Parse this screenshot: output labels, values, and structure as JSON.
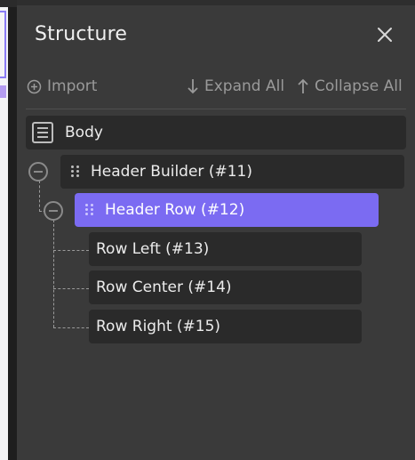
{
  "panel": {
    "title": "Structure"
  },
  "toolbar": {
    "import_label": "Import",
    "expand_all_label": "Expand All",
    "collapse_all_label": "Collapse All"
  },
  "tree": {
    "body": "Body",
    "header_builder": "Header Builder (#11)",
    "header_row": "Header Row (#12)",
    "row_left": "Row Left (#13)",
    "row_center": "Row Center (#14)",
    "row_right": "Row Right (#15)"
  },
  "colors": {
    "panel_bg": "#3a3a3a",
    "row_bg": "#2a2a2a",
    "selected_accent": "#7b6bf2"
  }
}
